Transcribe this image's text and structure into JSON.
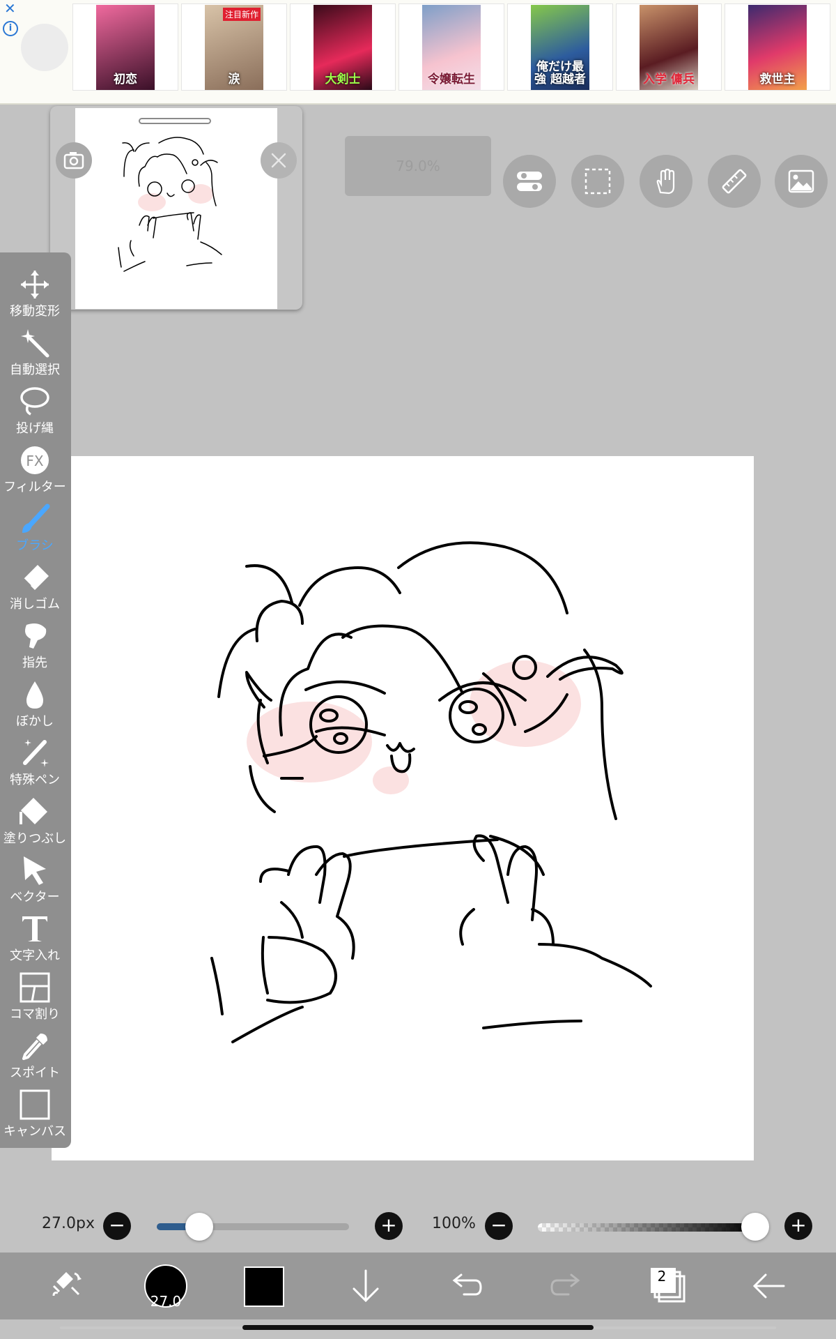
{
  "ad": {
    "titles": [
      "初恋",
      "涙",
      "大剣士",
      "令嬢転生",
      "俺だけ最強 超越者",
      "入学 傭兵",
      "救世主"
    ],
    "badge": "注目新作",
    "colors": [
      "#cf3b74",
      "#b79e86",
      "#d42250",
      "#f0b9c6",
      "#2f6fb6",
      "#7c2330",
      "#c8234d"
    ]
  },
  "navigator": {
    "camera_icon": "camera-icon",
    "close_icon": "close-icon"
  },
  "zoom": {
    "value": "79.0%"
  },
  "top_tools": [
    {
      "name": "toggle-icon"
    },
    {
      "name": "selection-icon"
    },
    {
      "name": "hand-icon"
    },
    {
      "name": "ruler-icon"
    },
    {
      "name": "image-icon"
    }
  ],
  "tools": [
    {
      "label": "移動変形",
      "icon": "move-icon"
    },
    {
      "label": "自動選択",
      "icon": "magic-wand-icon"
    },
    {
      "label": "投げ縄",
      "icon": "lasso-icon"
    },
    {
      "label": "フィルター",
      "icon": "fx-icon"
    },
    {
      "label": "ブラシ",
      "icon": "brush-icon",
      "active": true
    },
    {
      "label": "消しゴム",
      "icon": "eraser-icon"
    },
    {
      "label": "指先",
      "icon": "smudge-icon"
    },
    {
      "label": "ぼかし",
      "icon": "blur-icon"
    },
    {
      "label": "特殊ペン",
      "icon": "special-pen-icon"
    },
    {
      "label": "塗りつぶし",
      "icon": "fill-icon"
    },
    {
      "label": "ベクター",
      "icon": "vector-icon"
    },
    {
      "label": "文字入れ",
      "icon": "text-icon"
    },
    {
      "label": "コマ割り",
      "icon": "frame-icon"
    },
    {
      "label": "スポイト",
      "icon": "eyedropper-icon"
    },
    {
      "label": "キャンバス",
      "icon": "canvas-icon"
    }
  ],
  "brush": {
    "size_label": "27.0px",
    "size_value": 0.22,
    "opacity_label": "100%",
    "opacity_value": 1.0
  },
  "bottom": {
    "brush_size_short": "27.0",
    "layer_count": "2",
    "color": "#000000"
  }
}
